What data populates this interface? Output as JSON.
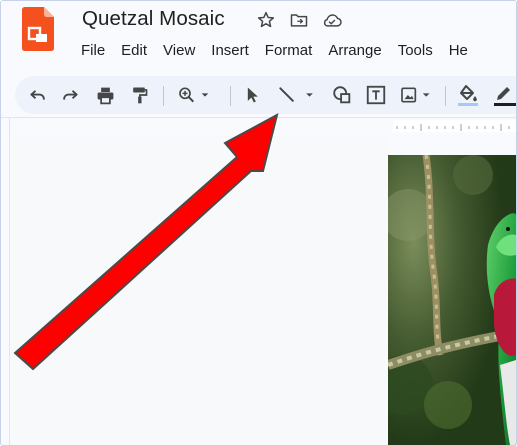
{
  "app": {
    "title": "Quetzal Mosaic",
    "brand_color": "#f4511e",
    "logo_icon": "slides-logo-icon"
  },
  "title_icons": [
    "star-icon",
    "move-to-folder-icon",
    "cloud-saved-icon"
  ],
  "menu": {
    "items": [
      "File",
      "Edit",
      "View",
      "Insert",
      "Format",
      "Arrange",
      "Tools",
      "He"
    ]
  },
  "toolbar": {
    "tools": [
      "undo-icon",
      "redo-icon",
      "print-icon",
      "paint-format-icon",
      "zoom-icon",
      "select-icon",
      "line-icon",
      "shape-icon",
      "text-box-icon",
      "image-icon",
      "fill-color-icon",
      "border-color-icon"
    ],
    "accent": "#1f1f1f"
  },
  "annotation": {
    "icon": "red-arrow-pointer",
    "color": "#ff0000",
    "outline": "#4a4a4a"
  },
  "slide": {
    "content": "quetzal-bird-photo"
  }
}
